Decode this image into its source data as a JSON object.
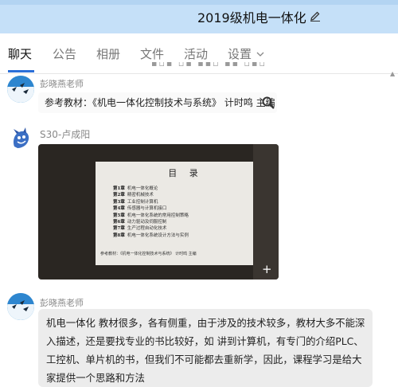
{
  "window": {
    "title": "2019级机电一体化"
  },
  "tabs": [
    {
      "label": "聊天",
      "active": true
    },
    {
      "label": "公告",
      "active": false
    },
    {
      "label": "相册",
      "active": false
    },
    {
      "label": "文件",
      "active": false
    },
    {
      "label": "活动",
      "active": false
    },
    {
      "label": "设置",
      "active": false
    }
  ],
  "messages": [
    {
      "sender": "彭晓燕老师",
      "text": "参考教材：《机电一体化控制技术与系统》  计时鸣 主编"
    },
    {
      "sender": "S30-卢成阳",
      "image": {
        "heading": "目 录",
        "chapters": [
          {
            "num": "第1章",
            "title": "机电一体化概论"
          },
          {
            "num": "第2章",
            "title": "精密机械技术"
          },
          {
            "num": "第3章",
            "title": "工业控制计算机"
          },
          {
            "num": "第4章",
            "title": "传感器与计算机接口"
          },
          {
            "num": "第5章",
            "title": "机电一体化系统的常用控制策略"
          },
          {
            "num": "第6章",
            "title": "动力驱动及伺服控制"
          },
          {
            "num": "第7章",
            "title": "生产过程自动化技术"
          },
          {
            "num": "第8章",
            "title": "机电一体化系统设计方法与实例"
          }
        ],
        "footer": "参考教材：《机电一体化控制技术与系统》  计时鸣 主编"
      }
    },
    {
      "sender": "彭晓燕老师",
      "lines": [
        "机电一体化 教材很多，各有侧重，由于涉及的技术较多，教材大多不能深",
        "入描述，还是要找专业的书比较好，如 讲到计算机，有专门的介绍PLC、",
        "工控机、单片机的书，但我们不可能都去重新学，因此，课程学习是给大",
        "家提供一个思路和方法"
      ]
    }
  ],
  "colors": {
    "titlebar": "#c5e0f8",
    "accent": "#2b6fd8",
    "bubble": "#ececec"
  }
}
